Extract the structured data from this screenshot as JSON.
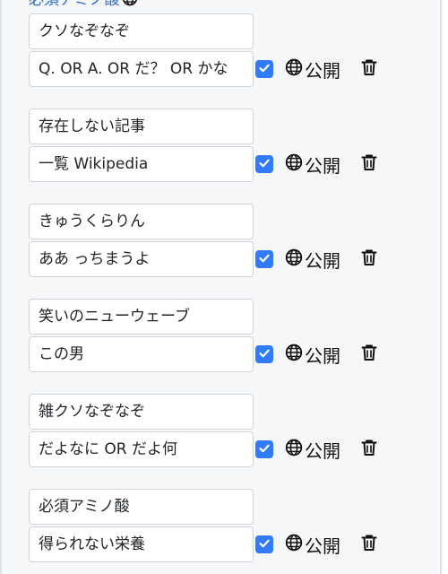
{
  "header": {
    "partial_title": "必須アミノ酸"
  },
  "entries": [
    {
      "title": "クソなぞなぞ",
      "query": "Q. OR A. OR だ？ OR かな",
      "checked": true,
      "public_label": "公開"
    },
    {
      "title": "存在しない記事",
      "query": "一覧 Wikipedia",
      "checked": true,
      "public_label": "公開"
    },
    {
      "title": "きゅうくらりん",
      "query": "ああ っちまうよ",
      "checked": true,
      "public_label": "公開"
    },
    {
      "title": "笑いのニューウェーブ",
      "query": "この男",
      "checked": true,
      "public_label": "公開"
    },
    {
      "title": "雑クソなぞなぞ",
      "query": "だよなに OR だよ何",
      "checked": true,
      "public_label": "公開"
    },
    {
      "title": "必須アミノ酸",
      "query": "得られない栄養",
      "checked": true,
      "public_label": "公開"
    }
  ],
  "colors": {
    "accent": "#2f7cf6",
    "link": "#2f6fd6",
    "panel_bg": "#f6f7f9"
  },
  "icons": {
    "globe": "globe-icon",
    "trash": "trash-icon",
    "check": "check-icon"
  }
}
